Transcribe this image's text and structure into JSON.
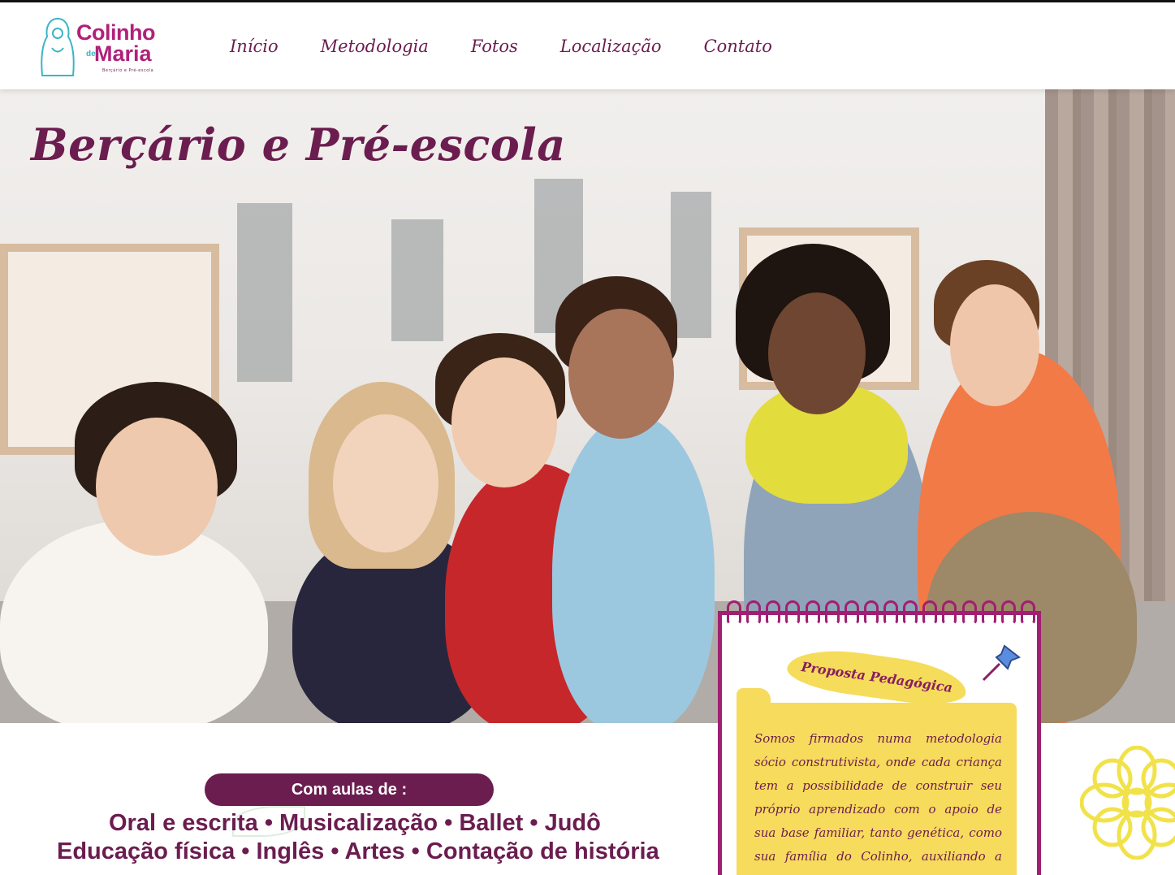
{
  "header": {
    "logo": {
      "line1": "Colinho",
      "de": "de",
      "line2": "Maria",
      "tagline": "Berçário e Pré-escola"
    },
    "nav": [
      {
        "label": "Início"
      },
      {
        "label": "Metodologia"
      },
      {
        "label": "Fotos"
      },
      {
        "label": "Localização"
      },
      {
        "label": "Contato"
      }
    ]
  },
  "hero": {
    "title": "Berçário e Pré-escola"
  },
  "proposta": {
    "title": "Proposta Pedagógica",
    "text": "Somos firmados numa metodologia sócio construtivista, onde cada criança tem a possibilidade de construir seu próprio aprendizado com o apoio de sua base familiar, tanto genética, como sua família do Colinho, auxiliando a essa"
  },
  "courses": {
    "header": "Com aulas de :",
    "line1": "Oral e escrita • Musicalização • Ballet • Judô",
    "line2": "Educação física • Inglês • Artes • Contação de história"
  },
  "colors": {
    "brand_purple": "#6b1d4f",
    "logo_magenta": "#b0217a",
    "note_yellow": "#f7db5c",
    "notebook_border": "#a01f72"
  }
}
